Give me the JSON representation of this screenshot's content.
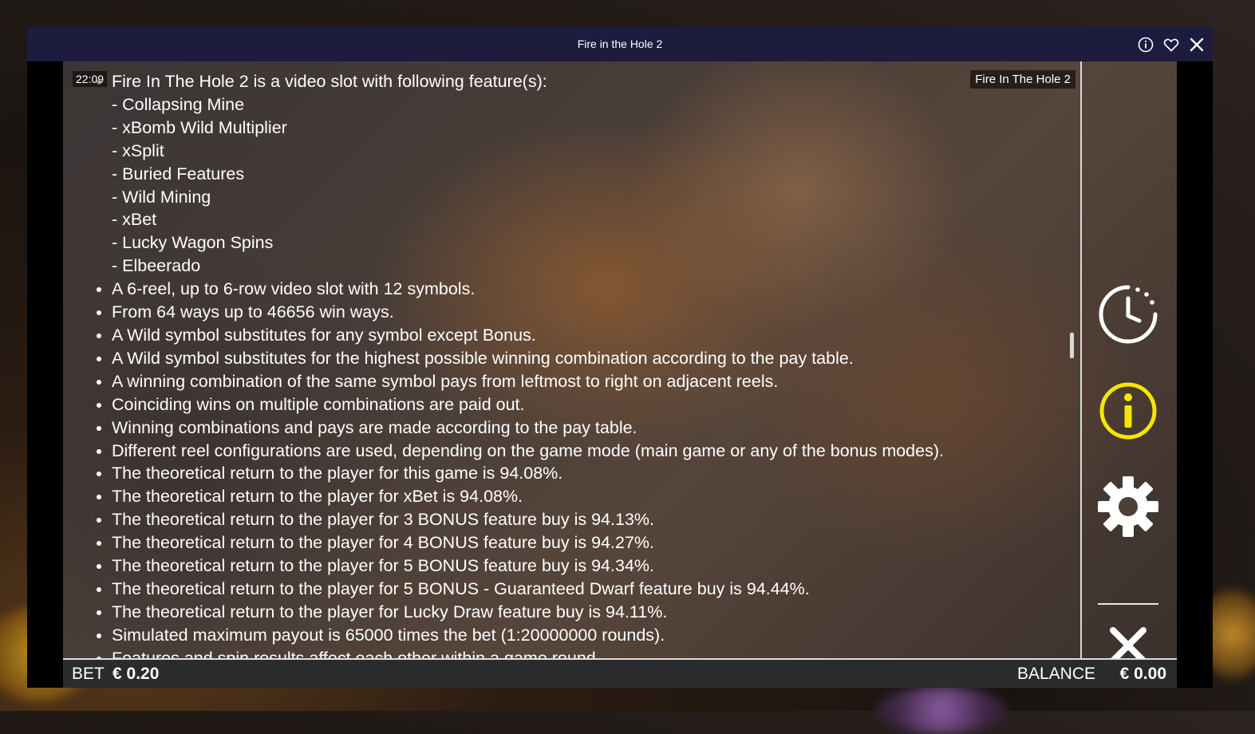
{
  "window": {
    "title": "Fire in the Hole 2"
  },
  "header_icons": [
    "info-icon",
    "heart-icon",
    "close-icon"
  ],
  "game": {
    "clock": "22:09",
    "label": "Fire In The Hole 2"
  },
  "info": {
    "intro": "Fire In The Hole 2 is a video slot with following feature(s):",
    "features": [
      "- Collapsing Mine",
      "- xBomb Wild Multiplier",
      "- xSplit",
      "- Buried Features",
      "- Wild Mining",
      "- xBet",
      "- Lucky Wagon Spins",
      "- Elbeerado"
    ],
    "bullets": [
      "A 6-reel, up to 6-row video slot with 12 symbols.",
      "From 64 ways up to 46656 win ways.",
      "A Wild symbol substitutes for any symbol except Bonus.",
      "A Wild symbol substitutes for the highest possible winning combination according to the pay table.",
      "A winning combination of the same symbol pays from leftmost to right on adjacent reels.",
      "Coinciding wins on multiple combinations are paid out.",
      "Winning combinations and pays are made according to the pay table.",
      "Different reel configurations are used, depending on the game mode (main game or any of the bonus modes).",
      "The theoretical return to the player for this game is 94.08%.",
      "The theoretical return to the player for xBet is 94.08%.",
      "The theoretical return to the player for 3 BONUS feature buy is 94.13%.",
      "The theoretical return to the player for 4 BONUS feature buy is 94.27%.",
      "The theoretical return to the player for 5 BONUS feature buy is 94.34%.",
      "The theoretical return to the player for 5 BONUS - Guaranteed Dwarf feature buy is 94.44%.",
      "The theoretical return to the player for Lucky Draw feature buy is 94.11%.",
      "Simulated maximum payout is 65000 times the bet (1:20000000 rounds).",
      "Features and spin results affect each other within a game round."
    ]
  },
  "sidebar": {
    "buttons": [
      "history-clock-icon",
      "info-circle-icon",
      "settings-gear-icon",
      "close-x-icon"
    ],
    "accent_color": "#f5e600"
  },
  "footer": {
    "bet_label": "BET",
    "bet_value": "€ 0.20",
    "balance_label": "BALANCE",
    "balance_value": "€ 0.00"
  }
}
